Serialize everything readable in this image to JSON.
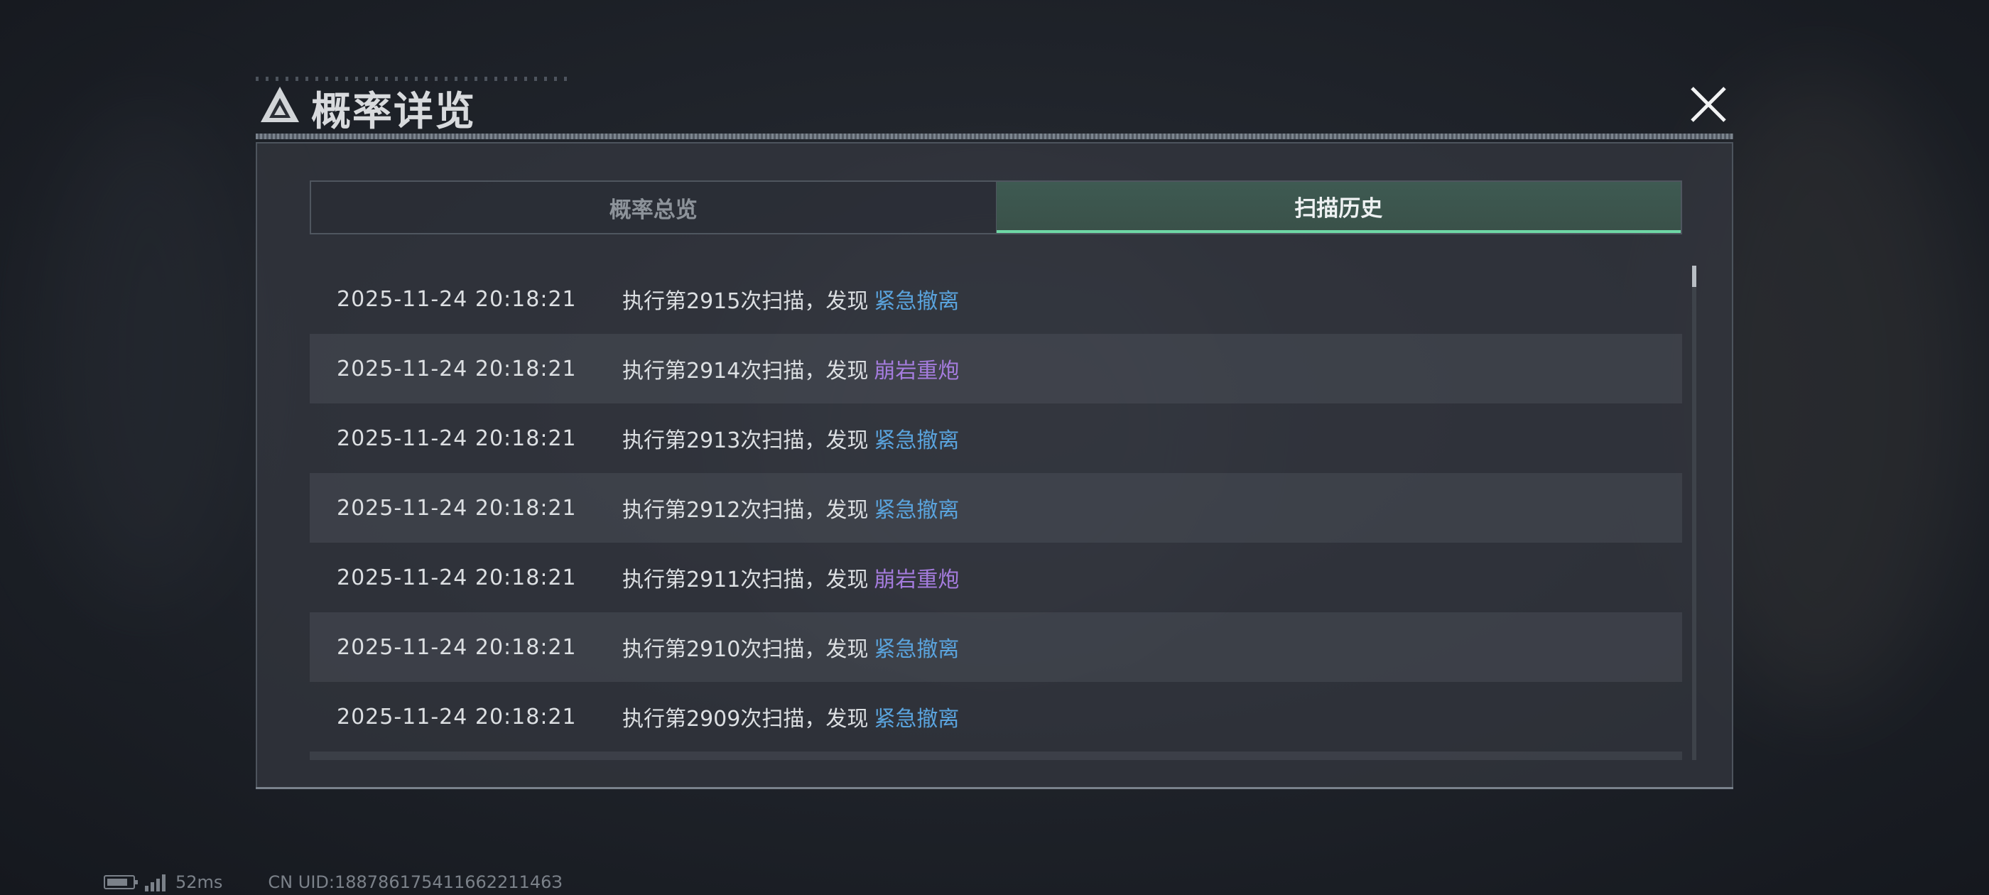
{
  "window": {
    "title": "概率详览"
  },
  "tabs": [
    {
      "label": "概率总览",
      "active": false
    },
    {
      "label": "扫描历史",
      "active": true
    }
  ],
  "history": [
    {
      "time": "2025-11-24 20:18:21",
      "message": "执行第2915次扫描，发现",
      "result": "紧急撤离",
      "result_color": "#5aa4de"
    },
    {
      "time": "2025-11-24 20:18:21",
      "message": "执行第2914次扫描，发现",
      "result": "崩岩重炮",
      "result_color": "#a57cde"
    },
    {
      "time": "2025-11-24 20:18:21",
      "message": "执行第2913次扫描，发现",
      "result": "紧急撤离",
      "result_color": "#5aa4de"
    },
    {
      "time": "2025-11-24 20:18:21",
      "message": "执行第2912次扫描，发现",
      "result": "紧急撤离",
      "result_color": "#5aa4de"
    },
    {
      "time": "2025-11-24 20:18:21",
      "message": "执行第2911次扫描，发现",
      "result": "崩岩重炮",
      "result_color": "#a57cde"
    },
    {
      "time": "2025-11-24 20:18:21",
      "message": "执行第2910次扫描，发现",
      "result": "紧急撤离",
      "result_color": "#5aa4de"
    },
    {
      "time": "2025-11-24 20:18:21",
      "message": "执行第2909次扫描，发现",
      "result": "紧急撤离",
      "result_color": "#5aa4de"
    }
  ],
  "status": {
    "ping": "52ms",
    "uid": "CN UID:18878617541166221146З"
  },
  "colors": {
    "accent": "#6fd7a6",
    "result_blue": "#5aa4de",
    "result_purple": "#a57cde"
  },
  "icons": {
    "logo": "triangle-logo-icon",
    "close": "close-icon",
    "battery": "battery-icon",
    "signal": "signal-icon"
  }
}
